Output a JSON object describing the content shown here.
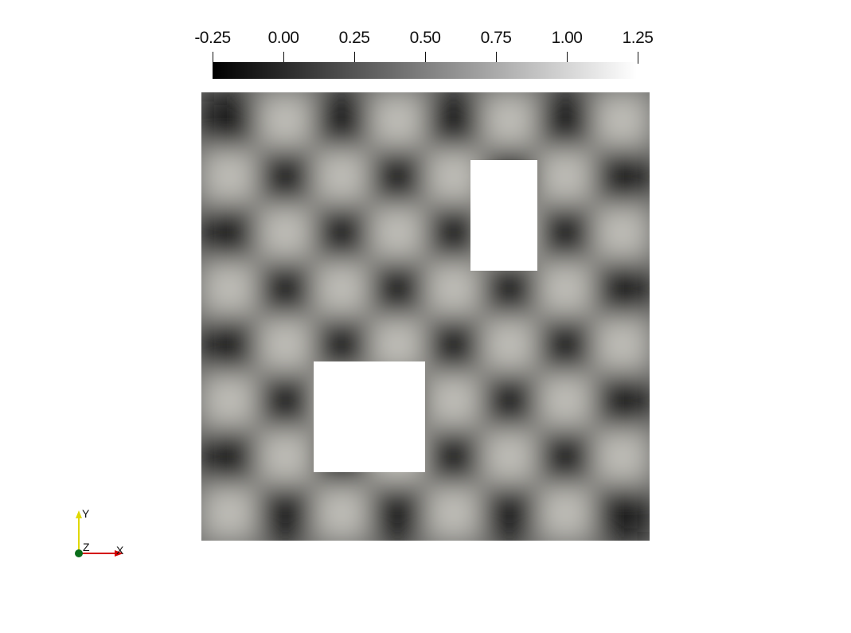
{
  "colorbar": {
    "ticks": [
      "-0.25",
      "0.00",
      "0.25",
      "0.50",
      "0.75",
      "1.00",
      "1.25"
    ],
    "range": [
      -0.25,
      1.25
    ],
    "color_low": "#000000",
    "color_high": "#ffffff"
  },
  "scene": {
    "background": "#ffffff",
    "field_dark": "#1a1a1a",
    "field_light": "#bdbcb6",
    "grid_cells": 8,
    "holes": [
      "rectangle-hole",
      "square-hole"
    ]
  },
  "orientation_axes": {
    "x_label": "X",
    "y_label": "Y",
    "z_label": "Z",
    "x_color": "#d40000",
    "y_color": "#e0d800",
    "z_color": "#0a6e1a"
  }
}
